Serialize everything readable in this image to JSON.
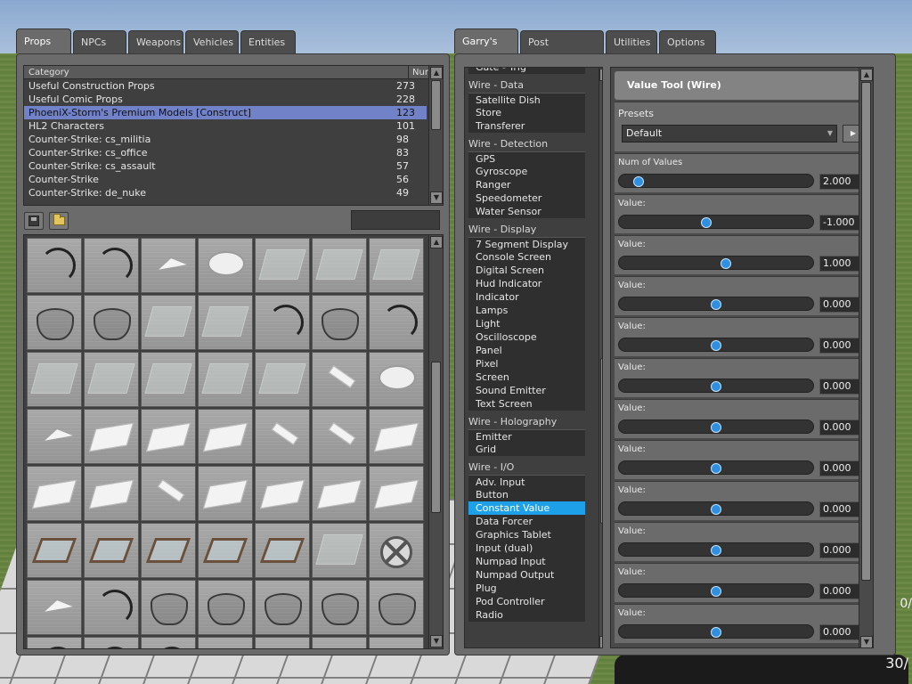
{
  "left_tabs": [
    {
      "label": "Props",
      "active": true
    },
    {
      "label": "NPCs",
      "active": false
    },
    {
      "label": "Weapons",
      "active": false
    },
    {
      "label": "Vehicles",
      "active": false
    },
    {
      "label": "Entities",
      "active": false
    }
  ],
  "right_tabs": [
    {
      "label": "Garry's Mod",
      "active": true
    },
    {
      "label": "Post Processing",
      "active": false
    },
    {
      "label": "Utilities",
      "active": false
    },
    {
      "label": "Options",
      "active": false
    }
  ],
  "category_list": {
    "header_category": "Category",
    "header_num": "Num",
    "rows": [
      {
        "name": "Useful Construction Props",
        "num": "273"
      },
      {
        "name": "Useful Comic Props",
        "num": "228"
      },
      {
        "name": "PhoeniX-Storm's Premium Models [Construct]",
        "num": "123"
      },
      {
        "name": "HL2 Characters",
        "num": "101"
      },
      {
        "name": "Counter-Strike: cs_militia",
        "num": "98"
      },
      {
        "name": "Counter-Strike: cs_office",
        "num": "83"
      },
      {
        "name": "Counter-Strike: cs_assault",
        "num": "57"
      },
      {
        "name": "Counter-Strike",
        "num": "56"
      },
      {
        "name": "Counter-Strike: de_nuke",
        "num": "49"
      }
    ],
    "selected_index": 2
  },
  "search": {
    "value": ""
  },
  "prop_icons": [
    "arc",
    "arc",
    "tri",
    "disk",
    "glass",
    "glass",
    "glass",
    "cyl",
    "cyl",
    "glass",
    "glass",
    "arc",
    "cyl",
    "arc",
    "glass",
    "glass",
    "glass",
    "glass",
    "glass",
    "strip",
    "disk",
    "tri",
    "plate",
    "plate",
    "plate",
    "strip",
    "strip",
    "plate",
    "plate",
    "plate",
    "strip",
    "plate",
    "plate",
    "plate",
    "plate",
    "frame",
    "frame",
    "frame",
    "frame",
    "frame",
    "glass",
    "wheel",
    "tri",
    "arc",
    "cyl",
    "cyl",
    "cyl",
    "cyl",
    "cyl",
    "arc",
    "arc",
    "arc",
    "glass",
    "red",
    "red",
    "glass"
  ],
  "tool_list": [
    {
      "type": "item",
      "label": "Gate - Trig"
    },
    {
      "type": "cat",
      "label": "Wire - Data"
    },
    {
      "type": "item",
      "label": "Satellite Dish"
    },
    {
      "type": "item",
      "label": "Store"
    },
    {
      "type": "item",
      "label": "Transferer"
    },
    {
      "type": "cat",
      "label": "Wire - Detection"
    },
    {
      "type": "item",
      "label": "GPS"
    },
    {
      "type": "item",
      "label": "Gyroscope"
    },
    {
      "type": "item",
      "label": "Ranger"
    },
    {
      "type": "item",
      "label": "Speedometer"
    },
    {
      "type": "item",
      "label": "Water Sensor"
    },
    {
      "type": "cat",
      "label": "Wire - Display"
    },
    {
      "type": "item",
      "label": "7 Segment Display"
    },
    {
      "type": "item",
      "label": "Console Screen"
    },
    {
      "type": "item",
      "label": "Digital Screen"
    },
    {
      "type": "item",
      "label": "Hud Indicator"
    },
    {
      "type": "item",
      "label": "Indicator"
    },
    {
      "type": "item",
      "label": "Lamps"
    },
    {
      "type": "item",
      "label": "Light"
    },
    {
      "type": "item",
      "label": "Oscilloscope"
    },
    {
      "type": "item",
      "label": "Panel"
    },
    {
      "type": "item",
      "label": "Pixel"
    },
    {
      "type": "item",
      "label": "Screen"
    },
    {
      "type": "item",
      "label": "Sound Emitter"
    },
    {
      "type": "item",
      "label": "Text Screen"
    },
    {
      "type": "cat",
      "label": "Wire - Holography"
    },
    {
      "type": "item",
      "label": "Emitter"
    },
    {
      "type": "item",
      "label": "Grid"
    },
    {
      "type": "cat",
      "label": "Wire - I/O"
    },
    {
      "type": "item",
      "label": "Adv. Input"
    },
    {
      "type": "item",
      "label": "Button"
    },
    {
      "type": "item",
      "label": "Constant Value",
      "selected": true
    },
    {
      "type": "item",
      "label": "Data Forcer"
    },
    {
      "type": "item",
      "label": "Graphics Tablet"
    },
    {
      "type": "item",
      "label": "Input (dual)"
    },
    {
      "type": "item",
      "label": "Numpad Input"
    },
    {
      "type": "item",
      "label": "Numpad Output"
    },
    {
      "type": "item",
      "label": "Plug"
    },
    {
      "type": "item",
      "label": "Pod Controller"
    },
    {
      "type": "item",
      "label": "Radio"
    }
  ],
  "control_panel": {
    "title": "Value Tool (Wire)",
    "presets_label": "Presets",
    "presets_value": "Default",
    "sliders": [
      {
        "label": "Num of Values",
        "value": "2.000",
        "fraction": 0.1
      },
      {
        "label": "Value:",
        "value": "-1.000",
        "fraction": 0.45
      },
      {
        "label": "Value:",
        "value": "1.000",
        "fraction": 0.55
      },
      {
        "label": "Value:",
        "value": "0.000",
        "fraction": 0.5
      },
      {
        "label": "Value:",
        "value": "0.000",
        "fraction": 0.5
      },
      {
        "label": "Value:",
        "value": "0.000",
        "fraction": 0.5
      },
      {
        "label": "Value:",
        "value": "0.000",
        "fraction": 0.5
      },
      {
        "label": "Value:",
        "value": "0.000",
        "fraction": 0.5
      },
      {
        "label": "Value:",
        "value": "0.000",
        "fraction": 0.5
      },
      {
        "label": "Value:",
        "value": "0.000",
        "fraction": 0.5
      },
      {
        "label": "Value:",
        "value": "0.000",
        "fraction": 0.5
      },
      {
        "label": "Value:",
        "value": "0.000",
        "fraction": 0.5
      }
    ]
  },
  "hud": {
    "ammo": "30/",
    "ammo_side": "0/"
  }
}
